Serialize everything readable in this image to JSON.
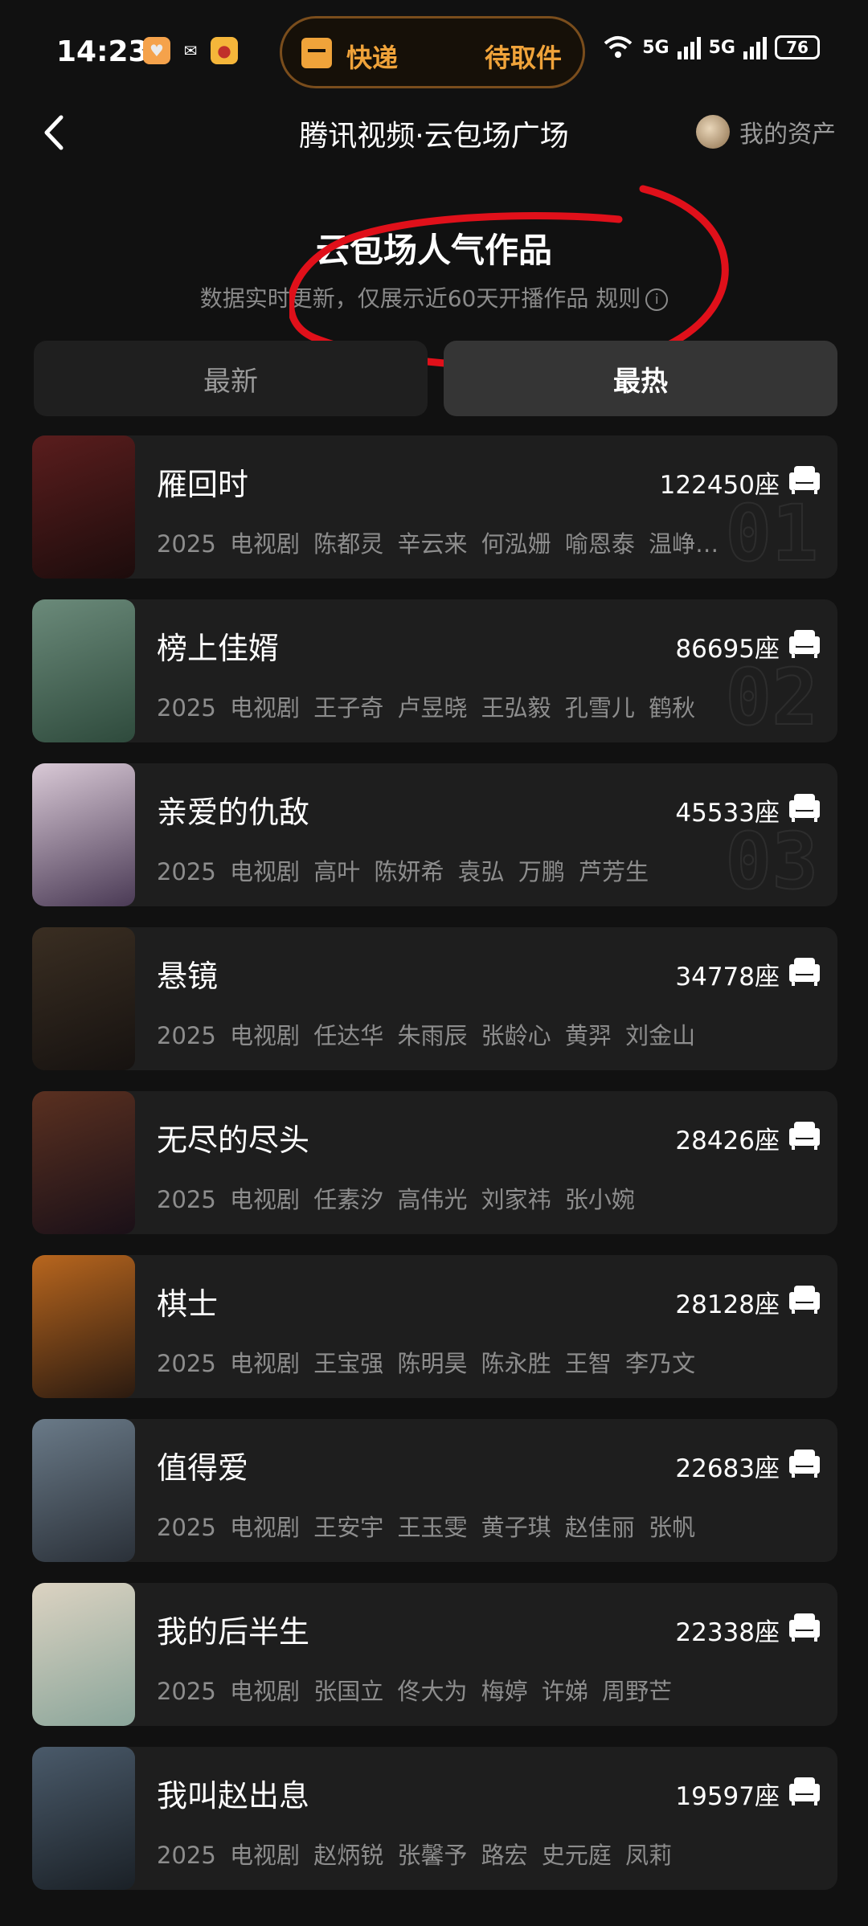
{
  "status_bar": {
    "time": "14:23",
    "delivery_left": "快递",
    "delivery_right": "待取件",
    "network1": "5G",
    "network2": "5G",
    "battery": "76"
  },
  "nav": {
    "title": "腾讯视频·云包场广场",
    "assets_label": "我的资产"
  },
  "header": {
    "title": "云包场人气作品",
    "subtitle": "数据实时更新，仅展示近60天开播作品",
    "rules_link": "规则",
    "annotation_color": "#e0101a"
  },
  "tabs": {
    "latest": "最新",
    "hot": "最热"
  },
  "list": [
    {
      "title": "雁回时",
      "seats": "122450座",
      "meta": "2025 电视剧 陈都灵 辛云来 何泓姗 喻恩泰 温峥…",
      "rank": "01",
      "poster_colors": [
        "#5a1d1d",
        "#1c0c0c"
      ]
    },
    {
      "title": "榜上佳婿",
      "seats": "86695座",
      "meta": "2025 电视剧 王子奇 卢昱晓 王弘毅 孔雪儿 鹤秋",
      "rank": "02",
      "poster_colors": [
        "#6b8a7a",
        "#2e4a3c"
      ]
    },
    {
      "title": "亲爱的仇敌",
      "seats": "45533座",
      "meta": "2025 电视剧 高叶 陈妍希 袁弘 万鹏 芦芳生",
      "rank": "03",
      "poster_colors": [
        "#d9c9d6",
        "#4a3a55"
      ]
    },
    {
      "title": "悬镜",
      "seats": "34778座",
      "meta": "2025 电视剧 任达华 朱雨辰 张龄心 黄羿 刘金山",
      "rank": "",
      "poster_colors": [
        "#3a2e22",
        "#161210"
      ]
    },
    {
      "title": "无尽的尽头",
      "seats": "28426座",
      "meta": "2025 电视剧 任素汐 高伟光 刘家祎 张小婉",
      "rank": "",
      "poster_colors": [
        "#5a3020",
        "#1a1018"
      ]
    },
    {
      "title": "棋士",
      "seats": "28128座",
      "meta": "2025 电视剧 王宝强 陈明昊 陈永胜 王智 李乃文",
      "rank": "",
      "poster_colors": [
        "#b8661e",
        "#2a1a10"
      ]
    },
    {
      "title": "值得爱",
      "seats": "22683座",
      "meta": "2025 电视剧 王安宇 王玉雯 黄子琪 赵佳丽 张帆",
      "rank": "",
      "poster_colors": [
        "#6a7a88",
        "#2a3038"
      ]
    },
    {
      "title": "我的后半生",
      "seats": "22338座",
      "meta": "2025 电视剧 张国立 佟大为 梅婷 许娣 周野芒",
      "rank": "",
      "poster_colors": [
        "#dcd3c2",
        "#8aa59a"
      ]
    },
    {
      "title": "我叫赵出息",
      "seats": "19597座",
      "meta": "2025 电视剧 赵炳锐 张馨予 路宏 史元庭 凤莉",
      "rank": "",
      "poster_colors": [
        "#4a5a6a",
        "#1a2026"
      ]
    }
  ]
}
